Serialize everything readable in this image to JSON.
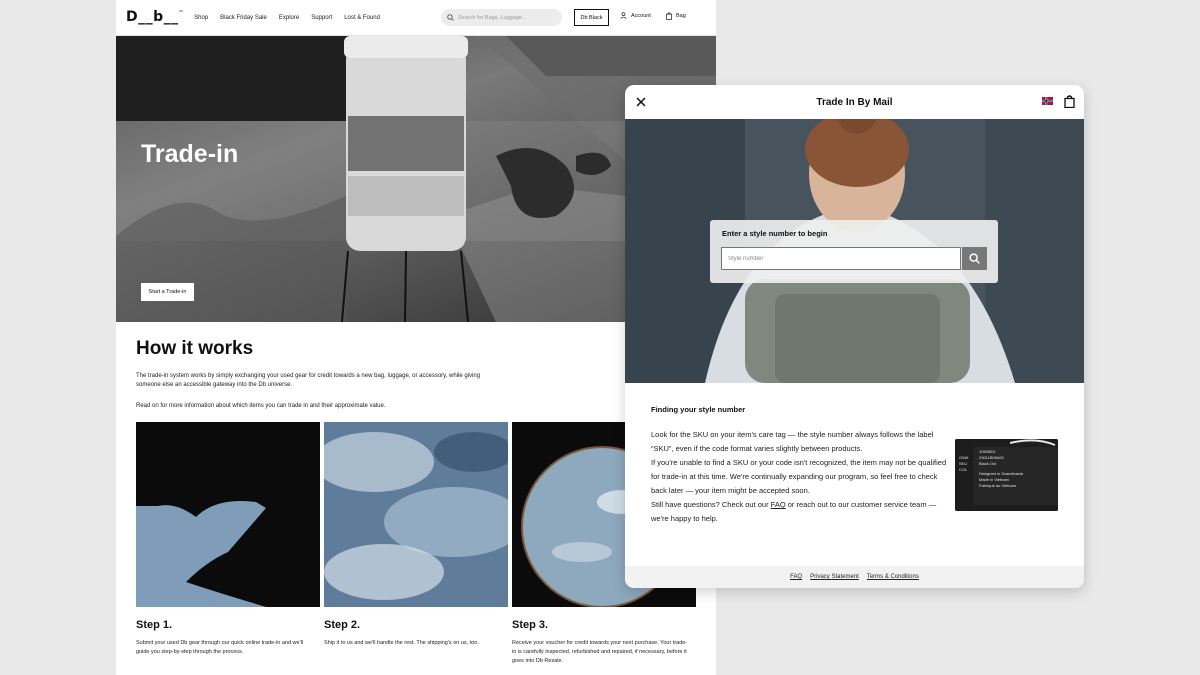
{
  "site": {
    "logo": "D__b__",
    "logo_mark": "™",
    "nav": [
      "Shop",
      "Black Friday Sale",
      "Explore",
      "Support",
      "Lost & Found"
    ],
    "search_placeholder": "Search for Bags, Luggage...",
    "db_black": "Db Black",
    "account": "Account",
    "bag": "Bag"
  },
  "hero": {
    "title": "Trade-in",
    "button": "Start a Trade-in"
  },
  "how": {
    "heading": "How it works",
    "intro": "The trade-in system works by simply exchanging your used gear for credit towards a new bag, luggage, or accessory, while giving someone else an accessible gateway into the Db universe.",
    "read_on": "Read on for more information about which items you can trade in and their approximate value."
  },
  "steps": [
    {
      "title": "Step 1.",
      "text": "Submit your used Db gear through our quick online trade-in and we'll guide you step-by-step through the process."
    },
    {
      "title": "Step 2.",
      "text": "Ship it to us and we'll handle the rest. The shipping's on us, too."
    },
    {
      "title": "Step 3.",
      "text": "Receive your voucher for credit towards your next purchase. Your trade-in is carefully inspected, refurbished and repaired, if necessary, before it goes into Db Resale."
    }
  ],
  "modal": {
    "title": "Trade In By Mail",
    "style_label": "Enter a style number to begin",
    "style_placeholder": "Style number",
    "find_title": "Finding your style number",
    "p1": "Look for the SKU on your item's care tag — the style number always follows the label “SKU”, even if the code format varies slightly between products.",
    "p2": "If you're unable to find a SKU or your code isn't recognized, the item may not be qualified for trade-in at this time. We're continually expanding our program, so feel free to check back later — your item might be accepted soon.",
    "p3_before": "Still have questions? Check out our ",
    "p3_link": "FAQ",
    "p3_after": " or reach out to our customer service team — we're happy to help.",
    "tag_lines": [
      "1HB0801",
      "23011B05A01",
      "Black Out",
      "Designed in Scandinavia",
      "Made in Vietnam",
      "Fabriqué au Vietnam"
    ],
    "tag_keys": [
      "GWA",
      "SKU",
      "COL"
    ],
    "footer": [
      "FAQ",
      "Privacy Statement",
      "Terms & Conditions"
    ]
  }
}
